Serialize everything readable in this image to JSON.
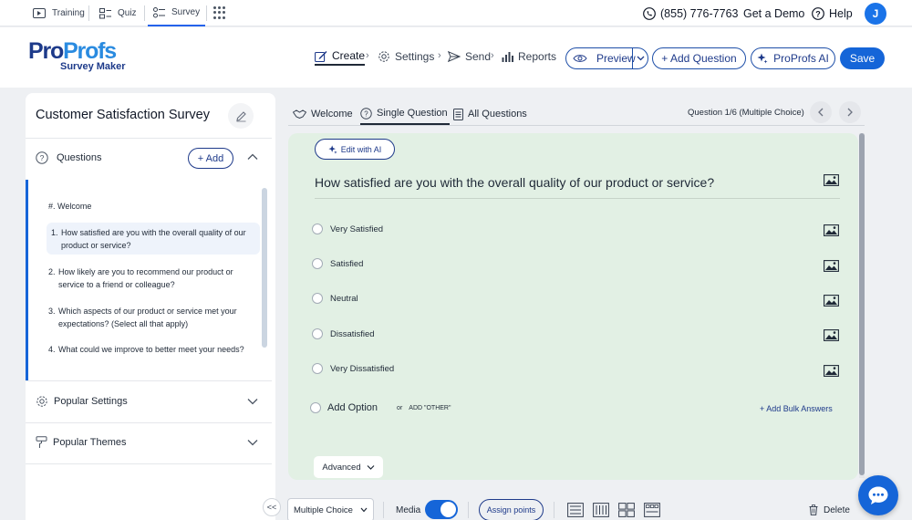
{
  "top_nav": {
    "tabs": [
      {
        "label": "Training",
        "icon": "training-icon"
      },
      {
        "label": "Quiz",
        "icon": "quiz-icon"
      },
      {
        "label": "Survey",
        "icon": "survey-icon",
        "active": true
      }
    ],
    "apps_icon": "apps-grid-icon",
    "phone": "(855) 776-7763",
    "demo": "Get a Demo",
    "help": "Help",
    "avatar_initial": "J"
  },
  "header": {
    "logo_part1": "Pro",
    "logo_part2": "Profs",
    "logo_sub": "Survey Maker",
    "steps": [
      {
        "label": "Create",
        "icon": "edit-icon",
        "active": true
      },
      {
        "label": "Settings",
        "icon": "gear-icon"
      },
      {
        "label": "Send",
        "icon": "send-icon"
      },
      {
        "label": "Reports",
        "icon": "bar-chart-icon"
      }
    ],
    "preview": "Preview",
    "add_question": "+ Add Question",
    "ai": "ProProfs AI",
    "save": "Save"
  },
  "sidebar": {
    "survey_title": "Customer Satisfaction Survey",
    "questions_label": "Questions",
    "add_label": "+ Add",
    "welcome_item": "#. Welcome",
    "questions": [
      {
        "num": "1.",
        "text": "How satisfied are you with the overall quality of our product or service?",
        "selected": true
      },
      {
        "num": "2.",
        "text": "How likely are you to recommend our product or service to a friend or colleague?"
      },
      {
        "num": "3.",
        "text": "Which aspects of our product or service met your expectations? (Select all that apply)"
      },
      {
        "num": "4.",
        "text": "What could we improve to better meet your needs?"
      }
    ],
    "popular_settings": "Popular Settings",
    "popular_themes": "Popular Themes"
  },
  "editor": {
    "tabs": [
      {
        "label": "Welcome",
        "icon": "welcome-icon"
      },
      {
        "label": "Single Question",
        "icon": "question-circle-icon",
        "active": true
      },
      {
        "label": "All Questions",
        "icon": "list-icon"
      }
    ],
    "counter": "Question 1/6 (Multiple Choice)",
    "edit_ai": "Edit with AI",
    "question": "How satisfied are you with the overall quality of our product or service?",
    "options": [
      "Very Satisfied",
      "Satisfied",
      "Neutral",
      "Dissatisfied",
      "Very Dissatisfied"
    ],
    "add_option": "Add Option",
    "or_label": "or",
    "add_other": "ADD \"OTHER\"",
    "bulk_answers": "+ Add Bulk Answers",
    "advanced": "Advanced"
  },
  "toolbar": {
    "collapse": "<<",
    "question_type": "Multiple Choice",
    "media_label": "Media",
    "media_on": true,
    "assign_points": "Assign points",
    "delete": "Delete"
  },
  "colors": {
    "primary": "#1565d8",
    "navy": "#1e3a8a",
    "card_bg": "#e2f0e4"
  }
}
